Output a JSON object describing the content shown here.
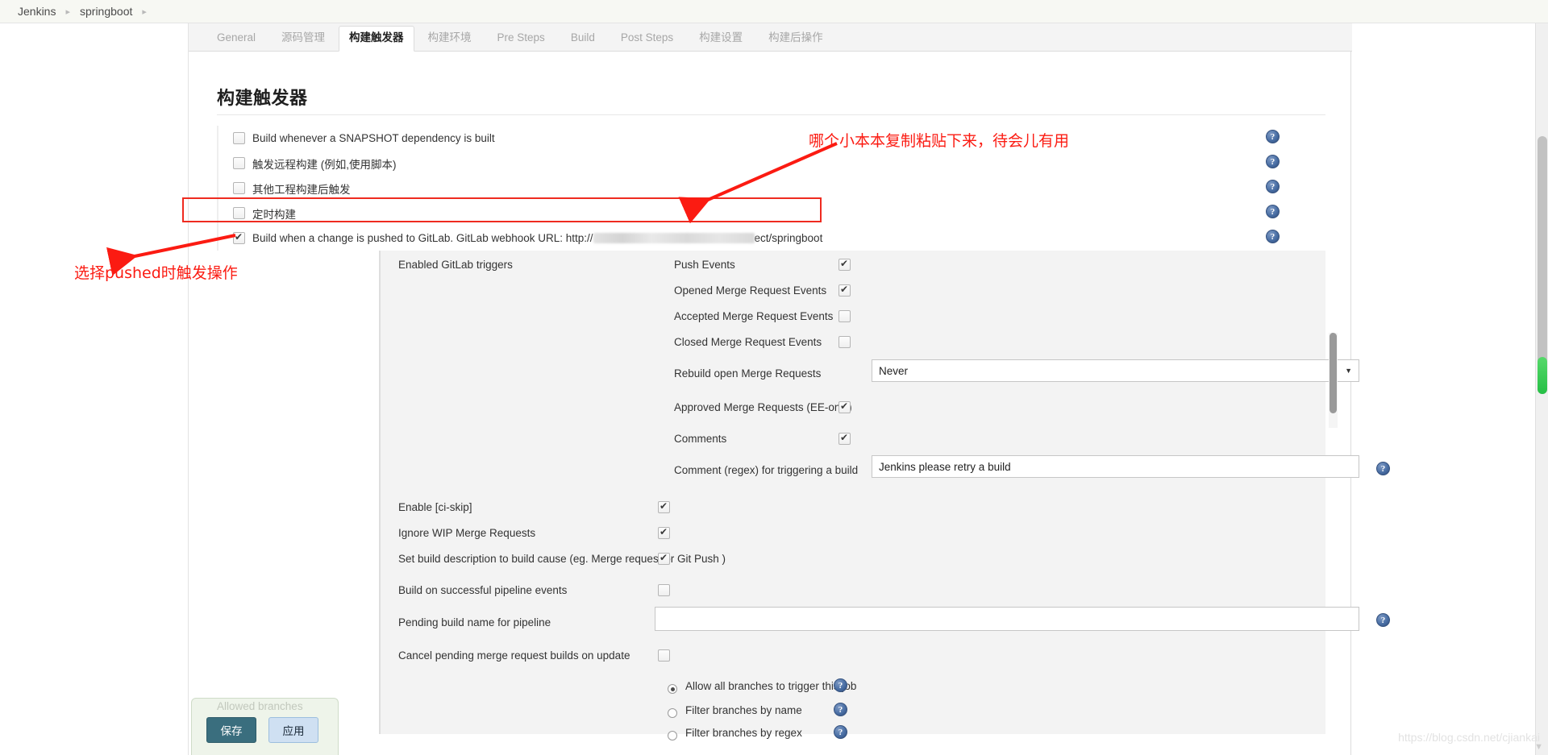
{
  "breadcrumb": {
    "items": [
      {
        "label": "Jenkins"
      },
      {
        "label": "springboot"
      }
    ],
    "separator": "▸"
  },
  "tabs": [
    {
      "label": "General",
      "active": false
    },
    {
      "label": "源码管理",
      "active": false
    },
    {
      "label": "构建触发器",
      "active": true
    },
    {
      "label": "构建环境",
      "active": false
    },
    {
      "label": "Pre Steps",
      "active": false
    },
    {
      "label": "Build",
      "active": false
    },
    {
      "label": "Post Steps",
      "active": false
    },
    {
      "label": "构建设置",
      "active": false
    },
    {
      "label": "构建后操作",
      "active": false
    }
  ],
  "page": {
    "title": "构建触发器"
  },
  "triggers": [
    {
      "label": "Build whenever a SNAPSHOT dependency is built",
      "checked": false
    },
    {
      "label": "触发远程构建 (例如,使用脚本)",
      "checked": false
    },
    {
      "label": "其他工程构建后触发",
      "checked": false
    },
    {
      "label": "定时构建",
      "checked": false
    },
    {
      "label": "Build when a change is pushed to GitLab. GitLab webhook URL: http://",
      "label_suffix": "ect/springboot",
      "checked": true,
      "redacted": true
    }
  ],
  "gitlab": {
    "enabled_triggers_label": "Enabled GitLab triggers",
    "events": [
      {
        "label": "Push Events",
        "checked": true
      },
      {
        "label": "Opened Merge Request Events",
        "checked": true
      },
      {
        "label": "Accepted Merge Request Events",
        "checked": false
      },
      {
        "label": "Closed Merge Request Events",
        "checked": false
      }
    ],
    "rebuild": {
      "label": "Rebuild open Merge Requests",
      "value": "Never",
      "caret": "▼"
    },
    "approved_mr": {
      "label": "Approved Merge Requests (EE-only)",
      "checked": true
    },
    "comments": {
      "label": "Comments",
      "checked": true
    },
    "comment_regex": {
      "label": "Comment (regex) for triggering a build",
      "value": "Jenkins please retry a build"
    },
    "options": [
      {
        "label": "Enable [ci-skip]",
        "checked": true
      },
      {
        "label": "Ignore WIP Merge Requests",
        "checked": true
      },
      {
        "label": "Set build description to build cause (eg. Merge request or Git Push )",
        "checked": true
      },
      {
        "label": "Build on successful pipeline events",
        "checked": false
      }
    ],
    "pending_build_name": {
      "label": "Pending build name for pipeline",
      "value": ""
    },
    "cancel_pending": {
      "label": "Cancel pending merge request builds on update",
      "checked": false
    },
    "allowed_branches_label": "Allowed branches",
    "branch_radios": [
      {
        "label": "Allow all branches to trigger this job",
        "selected": true
      },
      {
        "label": "Filter branches by name",
        "selected": false
      },
      {
        "label": "Filter branches by regex",
        "selected": false
      }
    ]
  },
  "buttons": {
    "save": "保存",
    "apply": "应用"
  },
  "annotations": [
    {
      "id": "webhook-note",
      "text": "哪个小本本复制粘贴下来，待会儿有用",
      "color": "#fb1b12"
    },
    {
      "id": "pushed-note",
      "text": "选择pushed时触发操作",
      "color": "#fb1b12"
    }
  ],
  "icons": {
    "help": "?"
  },
  "watermark": {
    "text": "https://blog.csdn.net/cjiankai"
  }
}
